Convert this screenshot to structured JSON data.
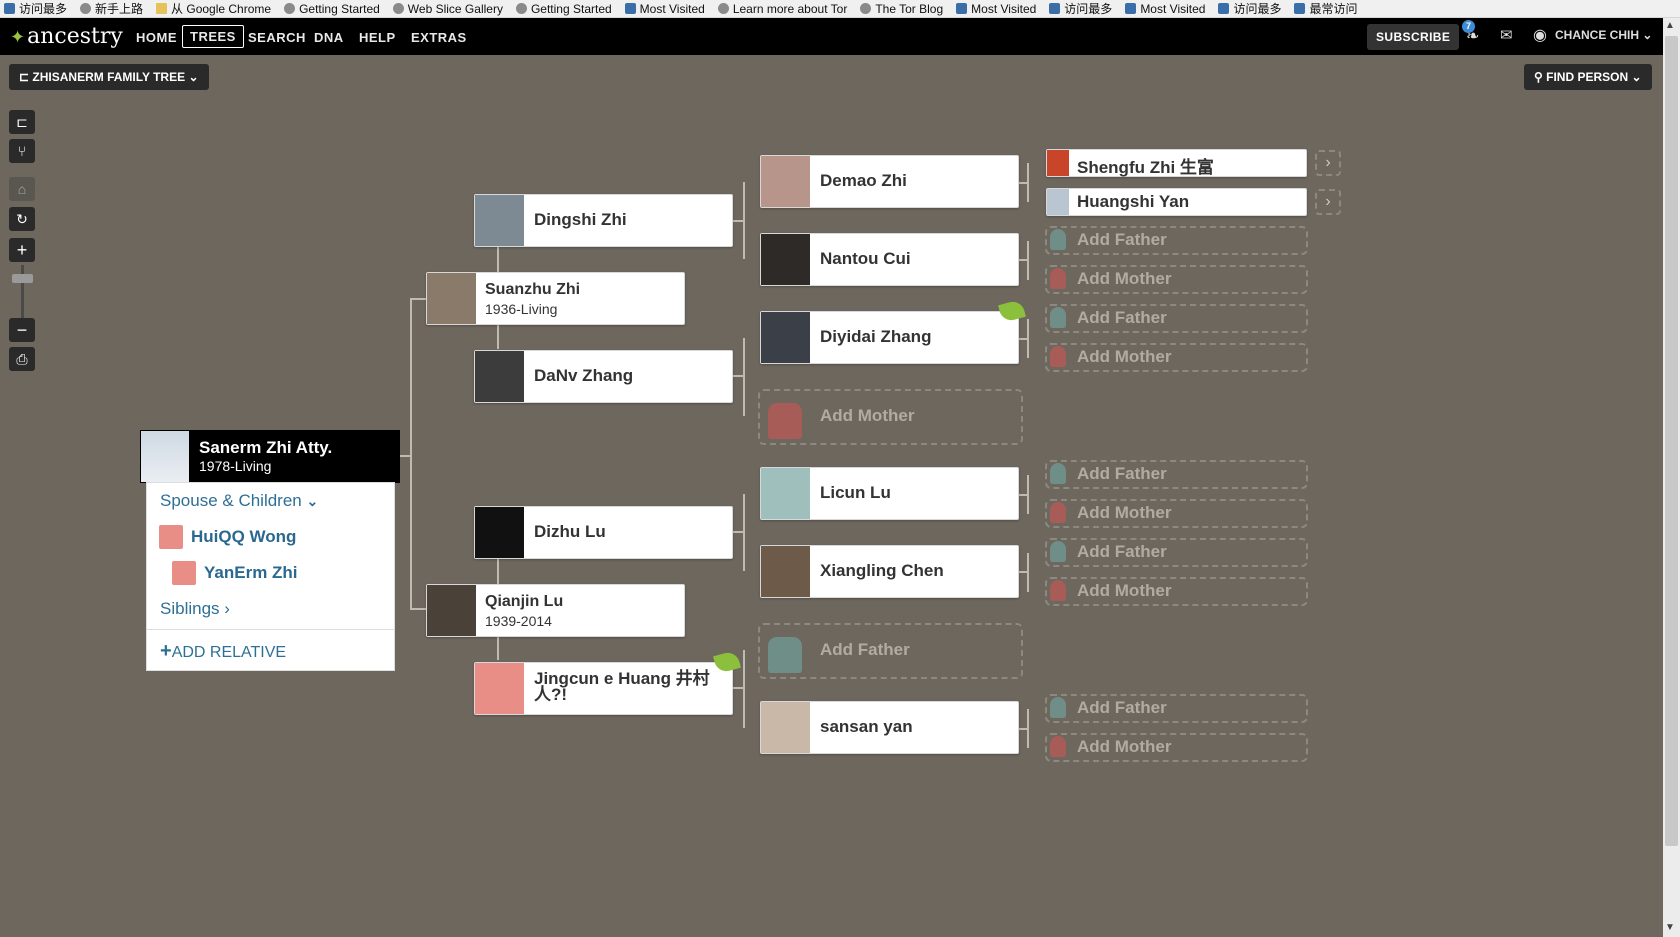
{
  "bookmarks": [
    "访问最多",
    "新手上路",
    "从 Google Chrome",
    "Getting Started",
    "Web Slice Gallery",
    "Getting Started",
    "Most Visited",
    "Learn more about Tor",
    "The Tor Blog",
    "Most Visited",
    "访问最多",
    "Most Visited",
    "访问最多",
    "最常访问"
  ],
  "nav": {
    "logo": "ancestry",
    "items": [
      "HOME",
      "TREES",
      "SEARCH",
      "DNA",
      "HELP",
      "EXTRAS"
    ],
    "active": "TREES",
    "subscribe": "SUBSCRIBE",
    "notif_count": "7",
    "user": "CHANCE CHIH"
  },
  "tree_bar": {
    "title": "ZHISANERM FAMILY TREE",
    "find": "FIND PERSON"
  },
  "focus": {
    "name": "Sanerm Zhi Atty.",
    "dates": "1978-Living",
    "spouse_children_label": "Spouse & Children",
    "spouse": "HuiQQ Wong",
    "child": "YanErm Zhi",
    "siblings_label": "Siblings",
    "add_relative": "ADD RELATIVE"
  },
  "people": {
    "suanzhu": {
      "name": "Suanzhu Zhi",
      "dates": "1936-Living"
    },
    "qianjin": {
      "name": "Qianjin Lu",
      "dates": "1939-2014"
    },
    "dingshi": {
      "name": "Dingshi Zhi"
    },
    "danv": {
      "name": "DaNv Zhang"
    },
    "dizhu": {
      "name": "Dizhu Lu"
    },
    "jingcun": {
      "name": "Jingcun e Huang 井村人?!"
    },
    "demao": {
      "name": "Demao Zhi"
    },
    "nantou": {
      "name": "Nantou Cui"
    },
    "diyidai": {
      "name": "Diyidai Zhang"
    },
    "licun": {
      "name": "Licun Lu"
    },
    "xiangling": {
      "name": "Xiangling Chen"
    },
    "sansan": {
      "name": "sansan yan"
    },
    "shengfu": {
      "name": "Shengfu Zhi 生富"
    },
    "huangshi": {
      "name": "Huangshi Yan"
    }
  },
  "labels": {
    "add_father": "Add Father",
    "add_mother": "Add Mother"
  },
  "colors": {
    "background": "#6d675e",
    "link": "#2e6f96",
    "hint_leaf": "#8bbf3c"
  }
}
